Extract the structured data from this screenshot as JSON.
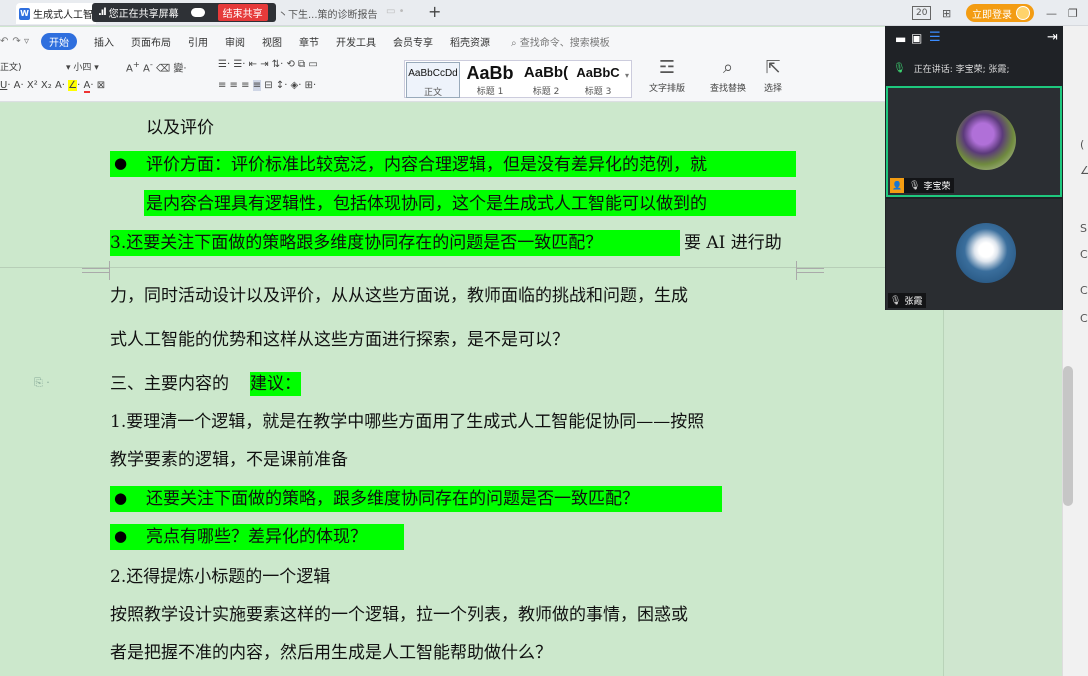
{
  "titlebar": {
    "active_tab": "生成式人工智",
    "share_text": "您正在共享屏幕",
    "end_share": "结束共享",
    "tab2_title": "丶下生...策的诊断报告",
    "add_tab": "+",
    "badge": "20",
    "login": "立即登录"
  },
  "ribbon": {
    "menu": [
      "开始",
      "插入",
      "页面布局",
      "引用",
      "审阅",
      "视图",
      "章节",
      "开发工具",
      "会员专享",
      "稻壳资源"
    ],
    "active_menu": "开始",
    "search_placeholder": "查找命令、搜索模板",
    "font_name": "正文)",
    "font_size": "小四",
    "styles": [
      {
        "sample": "AaBbCcDd",
        "name": "正文"
      },
      {
        "sample": "AaBb",
        "name": "标题 1"
      },
      {
        "sample": "AaBb(",
        "name": "标题 2"
      },
      {
        "sample": "AaBbC",
        "name": "标题 3"
      }
    ],
    "tools": {
      "text_layout": "文字排版",
      "find_replace": "查找替换",
      "select": "选择"
    }
  },
  "document": {
    "lines": [
      "以及评价",
      "评价方面：评价标准比较宽泛，内容合理逻辑，但是没有差异化的范例，就",
      "是内容合理具有逻辑性，包括体现协同，这个是生成式人工智能可以做到的",
      "3.还要关注下面做的策略跟多维度协同存在的问题是否一致匹配？",
      "要 AI 进行助",
      "力，同时活动设计以及评价，从从这些方面说，教师面临的挑战和问题，生成",
      "式人工智能的优势和这样从这些方面进行探索，是不是可以？",
      "三、主要内容的",
      "建议：",
      "1.要理清一个逻辑，就是在教学中哪些方面用了生成式人工智能促协同——按照",
      "教学要素的逻辑，不是课前准备",
      "还要关注下面做的策略，跟多维度协同存在的问题是否一致匹配？",
      "亮点有哪些？差异化的体现？",
      "2.还得提炼小标题的一个逻辑",
      "按照教学设计实施要素这样的一个逻辑，拉一个列表，教师做的事情，困惑或",
      "者是把握不准的内容，然后用生成是人工智能帮助做什么？"
    ]
  },
  "meeting": {
    "speaking_label": "正在讲话:",
    "speakers": "李宝荣; 张霞;",
    "participants": [
      "李宝荣",
      "张霞"
    ]
  },
  "colors": {
    "highlight": "#00ff00",
    "page": "#cce8cc",
    "accent": "#2f6fde",
    "active_border": "#1ec87e"
  }
}
